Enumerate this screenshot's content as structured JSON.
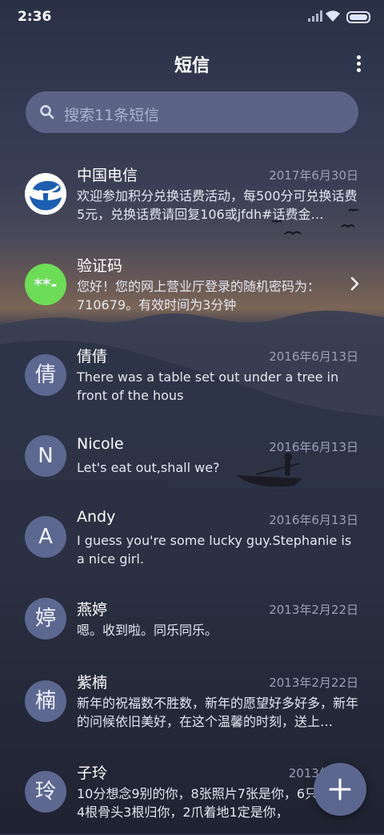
{
  "status": {
    "time": "2:36"
  },
  "header": {
    "title": "短信"
  },
  "search": {
    "placeholder": "搜索11条短信"
  },
  "conversations": [
    {
      "avatar": "",
      "name": "中国电信",
      "date": "2017年6月30日",
      "preview": "欢迎参加积分兑换话费活动，每500分可兑换话费5元，兑换话费请回复106或jfdh#话费金…"
    },
    {
      "avatar": "**-",
      "name": "验证码",
      "date": "",
      "preview": "您好！您的网上营业厅登录的随机密码为：710679。有效时间为3分钟"
    },
    {
      "avatar": "倩",
      "name": "倩倩",
      "date": "2016年6月13日",
      "preview": "There was a table set out under a tree in front of the hous"
    },
    {
      "avatar": "N",
      "name": "Nicole",
      "date": "2016年6月13日",
      "preview": "Let's eat out,shall we?"
    },
    {
      "avatar": "A",
      "name": "Andy",
      "date": "2016年6月13日",
      "preview": "I guess you're some lucky guy.Stephanie is a nice girl."
    },
    {
      "avatar": "婷",
      "name": "燕婷",
      "date": "2013年2月22日",
      "preview": "嗯。收到啦。同乐同乐。"
    },
    {
      "avatar": "楠",
      "name": "紫楠",
      "date": "2013年2月22日",
      "preview": "新年的祝福数不胜数，新年的愿望好多好多，新年的问候依旧美好，在这个温馨的时刻，送上…"
    },
    {
      "avatar": "玲",
      "name": "子玲",
      "date": "2013年2月2",
      "preview": "10分想念9别的你，8张照片7张是你，6只像你，4根骨头3根归你，2爪着地1定是你，"
    }
  ],
  "colors": {
    "accent": "#5c6790",
    "avatar_bg": "#5d6891",
    "search_bg": "#5b6386",
    "telecom_blue": "#1c5fb0",
    "verify_green": "#6ddc57"
  },
  "icons": {
    "search": "search-icon",
    "more": "more-vertical-icon",
    "chevron": "chevron-right-icon",
    "fab": "plus-icon"
  }
}
